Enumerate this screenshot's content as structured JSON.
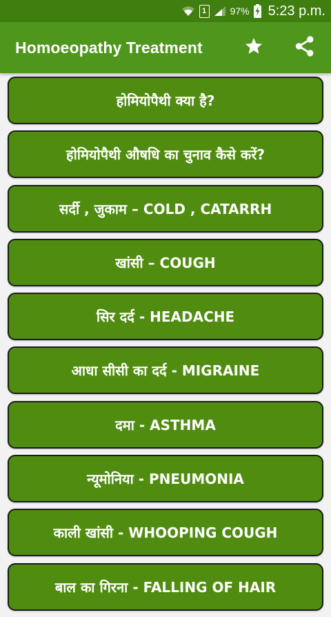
{
  "status_bar": {
    "sim_slot": "1",
    "battery_percent": "97%",
    "time": "5:23 p.m.",
    "icons": [
      "wifi-icon",
      "sim-icon",
      "signal-icon",
      "battery-charging-icon"
    ]
  },
  "app_bar": {
    "title": "Homoeopathy Treatment",
    "actions": [
      "star-icon",
      "share-icon"
    ]
  },
  "colors": {
    "status_bar": "#3f7f10",
    "app_bar": "#4f961d",
    "button": "#4f8c0f",
    "button_border": "#1b1b1b",
    "background": "#f2f2f2"
  },
  "topics": [
    {
      "label": "होमियोपैथी क्या है?"
    },
    {
      "label": "होमियोपैथी औषधि का चुनाव कैसे करें?"
    },
    {
      "label": "सर्दी , जुकाम – COLD , CATARRH"
    },
    {
      "label": "खांसी – COUGH"
    },
    {
      "label": "सिर दर्द - HEADACHE"
    },
    {
      "label": "आधा सीसी का दर्द - MIGRAINE"
    },
    {
      "label": "दमा - ASTHMA"
    },
    {
      "label": "न्यूमोनिया - PNEUMONIA"
    },
    {
      "label": "काली खांसी - WHOOPING COUGH"
    },
    {
      "label": "बाल का गिरना - FALLING OF HAIR"
    }
  ]
}
